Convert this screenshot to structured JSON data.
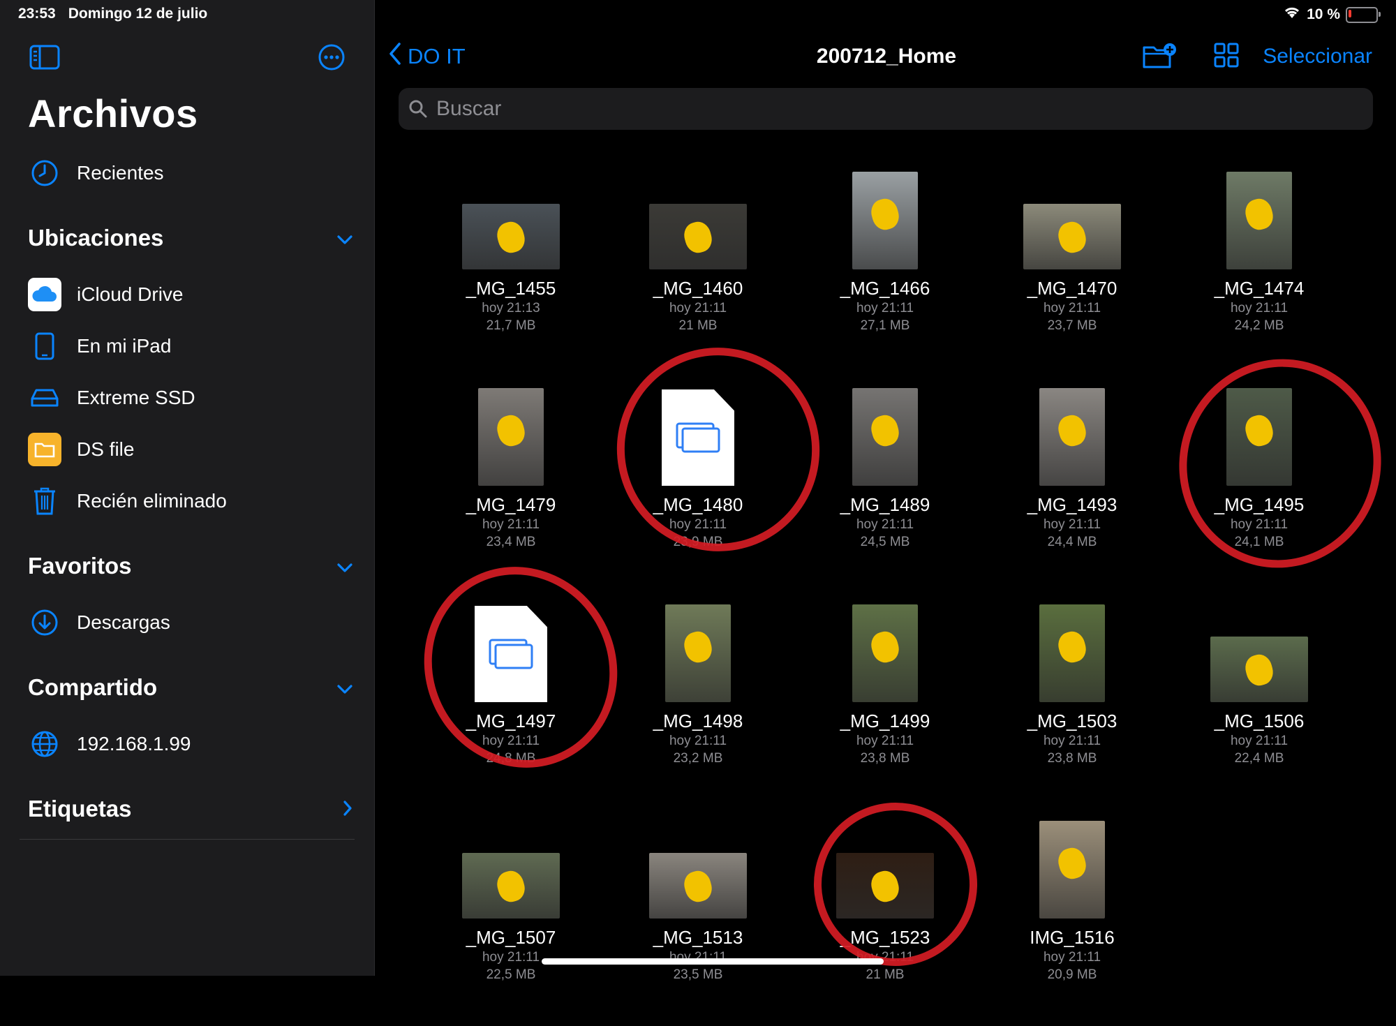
{
  "status_bar": {
    "time": "23:53",
    "date": "Domingo 12 de julio",
    "battery": "10 %",
    "battery_level": 0.1
  },
  "sidebar": {
    "title": "Archivos",
    "recents_label": "Recientes",
    "sections": {
      "locations": {
        "title": "Ubicaciones",
        "items": [
          "iCloud Drive",
          "En mi iPad",
          "Extreme SSD",
          "DS file",
          "Recién eliminado"
        ]
      },
      "favorites": {
        "title": "Favoritos",
        "items": [
          "Descargas"
        ]
      },
      "shared": {
        "title": "Compartido",
        "items": [
          "192.168.1.99"
        ]
      },
      "tags": {
        "title": "Etiquetas"
      }
    }
  },
  "navbar": {
    "back_label": "DO IT",
    "title": "200712_Home",
    "select_label": "Seleccionar"
  },
  "search": {
    "placeholder": "Buscar"
  },
  "files": [
    {
      "name": "_MG_1455",
      "date": "hoy 21:13",
      "size": "21,7 MB",
      "thumb": "landscape",
      "color": "#4a5157"
    },
    {
      "name": "_MG_1460",
      "date": "hoy 21:11",
      "size": "21 MB",
      "thumb": "landscape",
      "color": "#3b3a36"
    },
    {
      "name": "_MG_1466",
      "date": "hoy 21:11",
      "size": "27,1 MB",
      "thumb": "portrait",
      "color": "#9aa0a3"
    },
    {
      "name": "_MG_1470",
      "date": "hoy 21:11",
      "size": "23,7 MB",
      "thumb": "landscape",
      "color": "#8c8a7a"
    },
    {
      "name": "_MG_1474",
      "date": "hoy 21:11",
      "size": "24,2 MB",
      "thumb": "portrait",
      "color": "#6e7a66"
    },
    {
      "name": "_MG_1479",
      "date": "hoy 21:11",
      "size": "23,4 MB",
      "thumb": "portrait",
      "color": "#7e7a76"
    },
    {
      "name": "_MG_1480",
      "date": "hoy 21:11",
      "size": "23,9 MB",
      "thumb": "document",
      "color": "#ffffff"
    },
    {
      "name": "_MG_1489",
      "date": "hoy 21:11",
      "size": "24,5 MB",
      "thumb": "portrait",
      "color": "#767472"
    },
    {
      "name": "_MG_1493",
      "date": "hoy 21:11",
      "size": "24,4 MB",
      "thumb": "portrait",
      "color": "#8a8682"
    },
    {
      "name": "_MG_1495",
      "date": "hoy 21:11",
      "size": "24,1 MB",
      "thumb": "portrait",
      "color": "#4e5a48"
    },
    {
      "name": "_MG_1497",
      "date": "hoy 21:11",
      "size": "24,8 MB",
      "thumb": "document",
      "color": "#ffffff"
    },
    {
      "name": "_MG_1498",
      "date": "hoy 21:11",
      "size": "23,2 MB",
      "thumb": "portrait",
      "color": "#6f7a58"
    },
    {
      "name": "_MG_1499",
      "date": "hoy 21:11",
      "size": "23,8 MB",
      "thumb": "portrait",
      "color": "#5e7046"
    },
    {
      "name": "_MG_1503",
      "date": "hoy 21:11",
      "size": "23,8 MB",
      "thumb": "portrait",
      "color": "#5a6e3e"
    },
    {
      "name": "_MG_1506",
      "date": "hoy 21:11",
      "size": "22,4 MB",
      "thumb": "landscape",
      "color": "#5b6b4c"
    },
    {
      "name": "_MG_1507",
      "date": "hoy 21:11",
      "size": "22,5 MB",
      "thumb": "landscape",
      "color": "#5f6a52"
    },
    {
      "name": "_MG_1513",
      "date": "hoy 21:11",
      "size": "23,5 MB",
      "thumb": "landscape",
      "color": "#8a857e"
    },
    {
      "name": "_MG_1523",
      "date": "hoy 21:11",
      "size": "21 MB",
      "thumb": "landscape",
      "color": "#2e1e14"
    },
    {
      "name": "IMG_1516",
      "date": "hoy 21:11",
      "size": "20,9 MB",
      "thumb": "portrait",
      "color": "#9b8f7a"
    }
  ]
}
